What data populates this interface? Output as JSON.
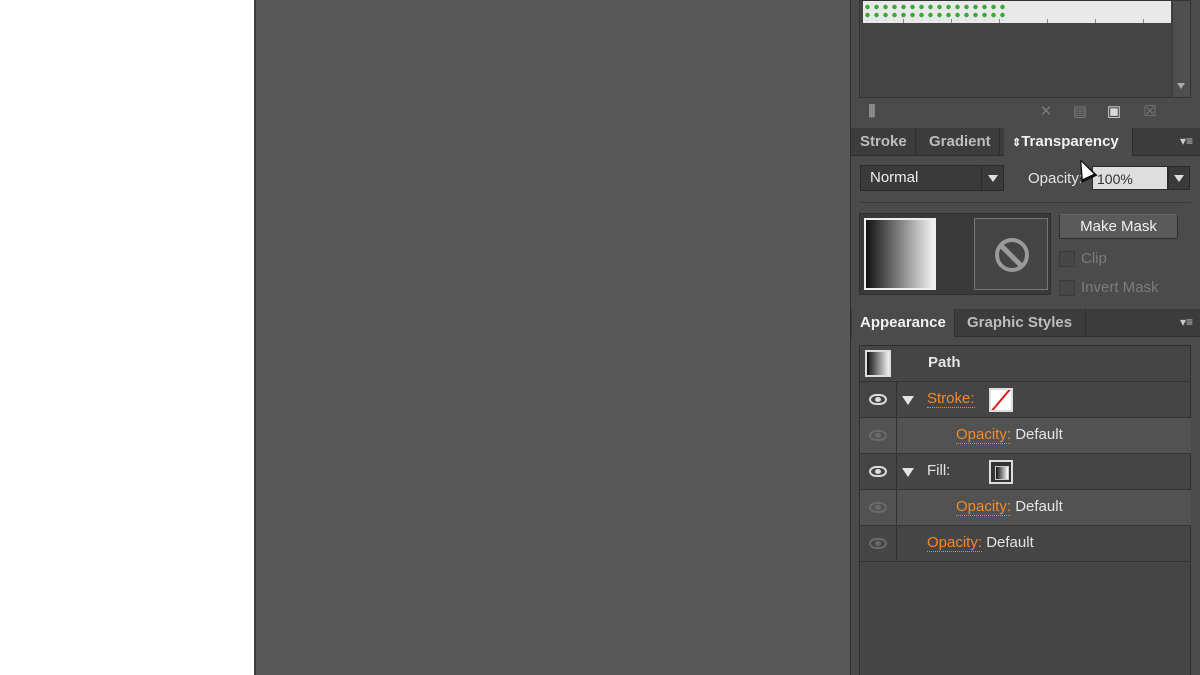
{
  "transparency_panel": {
    "tabs": [
      {
        "label": "Stroke"
      },
      {
        "label": "Gradient"
      },
      {
        "label": "Transparency"
      }
    ],
    "blend_mode": "Normal",
    "opacity_label": "Opacity:",
    "opacity_value": "100%",
    "make_mask_label": "Make Mask",
    "clip_label": "Clip",
    "invert_mask_label": "Invert Mask"
  },
  "appearance_panel": {
    "tabs": [
      {
        "label": "Appearance"
      },
      {
        "label": "Graphic Styles"
      }
    ],
    "object_label": "Path",
    "rows": [
      {
        "attribute": "Stroke:"
      },
      {
        "attribute": "Opacity:",
        "value": "Default"
      },
      {
        "attribute": "Fill:"
      },
      {
        "attribute": "Opacity:",
        "value": "Default"
      },
      {
        "attribute": "Opacity:",
        "value": "Default"
      }
    ]
  },
  "colors": {
    "link_orange": "#f28a2a",
    "panel_bg": "#4b4b4b",
    "canvas_bg": "#585858"
  },
  "icons": [
    "library-icon",
    "break-link-icon",
    "swatch-options-icon",
    "new-swatch-icon",
    "trash-icon",
    "panel-menu-icon",
    "no-mask-icon",
    "eye-icon",
    "disclosure-triangle-icon"
  ]
}
